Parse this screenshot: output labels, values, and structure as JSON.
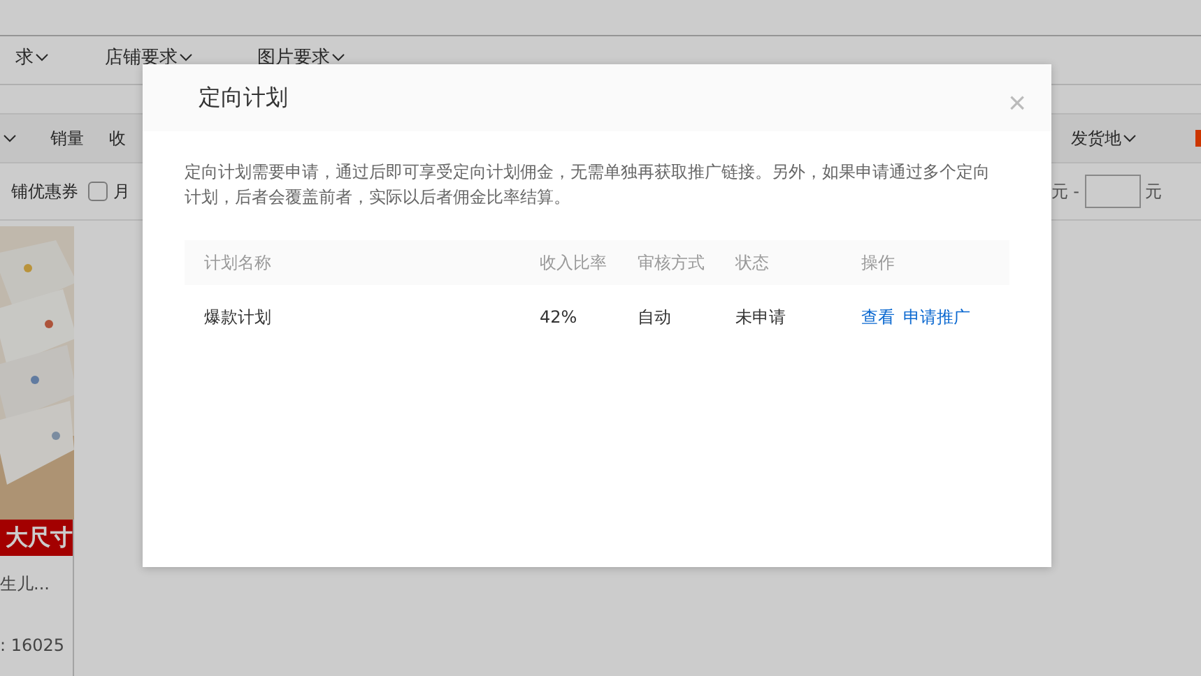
{
  "filters": [
    "求",
    "店铺要求",
    "图片要求"
  ],
  "sort_bar": {
    "items": [
      "销量",
      "收"
    ],
    "right": "发货地"
  },
  "options": {
    "coupon": "铺优惠券",
    "checkbox": {
      "label": "月",
      "checked": false
    },
    "price_from_unit": "元 -",
    "price_to_unit": "元"
  },
  "product": {
    "banner": "大尺寸",
    "title": "生儿...",
    "sales": ": 16025"
  },
  "dialog": {
    "title": "定向计划",
    "close": "×",
    "description": "定向计划需要申请，通过后即可享受定向计划佣金，无需单独再获取推广链接。另外，如果申请通过多个定向计划，后者会覆盖前者，实际以后者佣金比率结算。",
    "table": {
      "columns": [
        "计划名称",
        "收入比率",
        "审核方式",
        "状态",
        "操作"
      ],
      "rows": [
        {
          "name": "爆款计划",
          "ratio": "42%",
          "review": "自动",
          "status": "未申请",
          "actions": [
            "查看",
            "申请推广"
          ]
        }
      ]
    }
  }
}
